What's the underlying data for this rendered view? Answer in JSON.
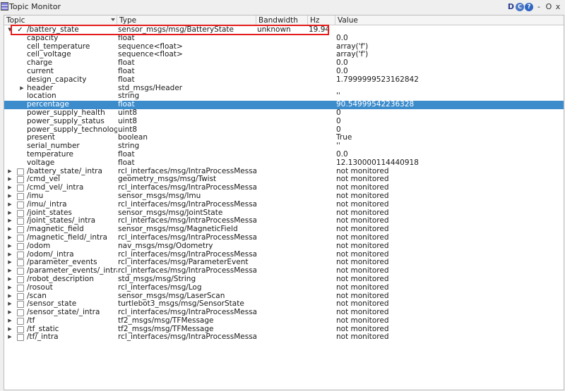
{
  "window": {
    "title": "Topic Monitor",
    "controls": {
      "d": "D",
      "c": "C",
      "help": "?",
      "minimize": "-",
      "o": "O",
      "close": "x"
    }
  },
  "columns": {
    "topic": "Topic",
    "type": "Type",
    "bandwidth": "Bandwidth",
    "hz": "Hz",
    "value": "Value"
  },
  "selected_topic": {
    "topic": "/battery_state",
    "type": "sensor_msgs/msg/BatteryState",
    "bandwidth": "unknown",
    "hz": "19.94",
    "fields": [
      {
        "name": "capacity",
        "type": "float",
        "value": "0.0"
      },
      {
        "name": "cell_temperature",
        "type": "sequence<float>",
        "value": "array('f')"
      },
      {
        "name": "cell_voltage",
        "type": "sequence<float>",
        "value": "array('f')"
      },
      {
        "name": "charge",
        "type": "float",
        "value": "0.0"
      },
      {
        "name": "current",
        "type": "float",
        "value": "0.0"
      },
      {
        "name": "design_capacity",
        "type": "float",
        "value": "1.7999999523162842"
      },
      {
        "name": "header",
        "type": "std_msgs/Header",
        "value": "",
        "expandable": true
      },
      {
        "name": "location",
        "type": "string",
        "value": "''"
      },
      {
        "name": "percentage",
        "type": "float",
        "value": "90.54999542236328",
        "selected": true
      },
      {
        "name": "power_supply_health",
        "type": "uint8",
        "value": "0"
      },
      {
        "name": "power_supply_status",
        "type": "uint8",
        "value": "0"
      },
      {
        "name": "power_supply_technology",
        "type": "uint8",
        "value": "0"
      },
      {
        "name": "present",
        "type": "boolean",
        "value": "True"
      },
      {
        "name": "serial_number",
        "type": "string",
        "value": "''"
      },
      {
        "name": "temperature",
        "type": "float",
        "value": "0.0"
      },
      {
        "name": "voltage",
        "type": "float",
        "value": "12.130000114440918"
      }
    ]
  },
  "topics": [
    {
      "topic": "/battery_state/_intra",
      "type": "rcl_interfaces/msg/IntraProcessMessage",
      "value": "not monitored"
    },
    {
      "topic": "/cmd_vel",
      "type": "geometry_msgs/msg/Twist",
      "value": "not monitored"
    },
    {
      "topic": "/cmd_vel/_intra",
      "type": "rcl_interfaces/msg/IntraProcessMessage",
      "value": "not monitored"
    },
    {
      "topic": "/imu",
      "type": "sensor_msgs/msg/Imu",
      "value": "not monitored"
    },
    {
      "topic": "/imu/_intra",
      "type": "rcl_interfaces/msg/IntraProcessMessage",
      "value": "not monitored"
    },
    {
      "topic": "/joint_states",
      "type": "sensor_msgs/msg/JointState",
      "value": "not monitored"
    },
    {
      "topic": "/joint_states/_intra",
      "type": "rcl_interfaces/msg/IntraProcessMessage",
      "value": "not monitored"
    },
    {
      "topic": "/magnetic_field",
      "type": "sensor_msgs/msg/MagneticField",
      "value": "not monitored"
    },
    {
      "topic": "/magnetic_field/_intra",
      "type": "rcl_interfaces/msg/IntraProcessMessage",
      "value": "not monitored"
    },
    {
      "topic": "/odom",
      "type": "nav_msgs/msg/Odometry",
      "value": "not monitored"
    },
    {
      "topic": "/odom/_intra",
      "type": "rcl_interfaces/msg/IntraProcessMessage",
      "value": "not monitored"
    },
    {
      "topic": "/parameter_events",
      "type": "rcl_interfaces/msg/ParameterEvent",
      "value": "not monitored"
    },
    {
      "topic": "/parameter_events/_intra",
      "type": "rcl_interfaces/msg/IntraProcessMessage",
      "value": "not monitored"
    },
    {
      "topic": "/robot_description",
      "type": "std_msgs/msg/String",
      "value": "not monitored"
    },
    {
      "topic": "/rosout",
      "type": "rcl_interfaces/msg/Log",
      "value": "not monitored"
    },
    {
      "topic": "/scan",
      "type": "sensor_msgs/msg/LaserScan",
      "value": "not monitored"
    },
    {
      "topic": "/sensor_state",
      "type": "turtlebot3_msgs/msg/SensorState",
      "value": "not monitored"
    },
    {
      "topic": "/sensor_state/_intra",
      "type": "rcl_interfaces/msg/IntraProcessMessage",
      "value": "not monitored"
    },
    {
      "topic": "/tf",
      "type": "tf2_msgs/msg/TFMessage",
      "value": "not monitored"
    },
    {
      "topic": "/tf_static",
      "type": "tf2_msgs/msg/TFMessage",
      "value": "not monitored"
    },
    {
      "topic": "/tf/_intra",
      "type": "rcl_interfaces/msg/IntraProcessMessage",
      "value": "not monitored"
    }
  ],
  "colors": {
    "selection": "#3c8ccc",
    "highlight_box": "#e51b1b"
  }
}
